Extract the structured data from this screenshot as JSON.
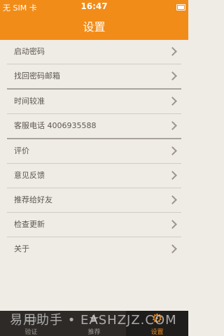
{
  "status": {
    "carrier": "无 SIM 卡",
    "time": "16:47",
    "battery_label": "100%"
  },
  "header": {
    "title": "设置"
  },
  "rows": [
    {
      "label": "启动密码"
    },
    {
      "label": "找回密码邮箱"
    },
    {
      "label": "时间较准"
    },
    {
      "label": "客服电话 4006935588"
    },
    {
      "label": "评价"
    },
    {
      "label": "意见反馈"
    },
    {
      "label": "推荐给好友"
    },
    {
      "label": "检查更新"
    },
    {
      "label": "关于"
    }
  ],
  "tabs": [
    {
      "label": "验证",
      "icon": "card-icon"
    },
    {
      "label": "推荐",
      "icon": "star-icon"
    },
    {
      "label": "设置",
      "icon": "gear-icon"
    }
  ],
  "watermark": "易用助手 • EASHZJZ.COM"
}
